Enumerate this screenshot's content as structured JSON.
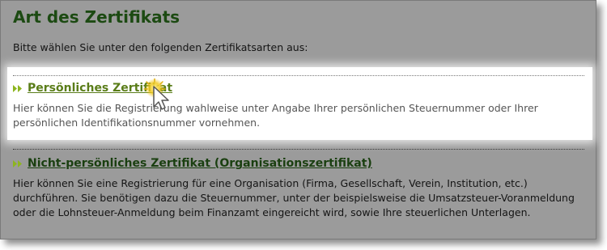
{
  "title": "Art des Zertifikats",
  "intro": "Bitte wählen Sie unter den folgenden Zertifikatsarten aus:",
  "options": [
    {
      "label": "Persönliches Zertifikat",
      "description": "Hier können Sie die Registrierung wahlweise unter Angabe Ihrer persönlichen Steuernummer oder Ihrer persönlichen Identifikationsnummer vornehmen."
    },
    {
      "label": "Nicht-persönliches Zertifikat (Organisationszertifikat)",
      "description": "Hier können Sie eine Registrierung für eine Organisation (Firma, Gesellschaft, Verein, Institution, etc.) durchführen. Sie benötigen dazu die Steuernummer, unter der beispielsweise die Umsatzsteuer-Voranmeldung oder die Lohnsteuer-Anmeldung beim Finanzamt eingereicht wird, sowie Ihre steuerlichen Unterlagen."
    }
  ],
  "colors": {
    "panel_background": "#9b9b9b",
    "highlight_background": "#ffffff",
    "title": "#1c4a12",
    "link_hover": "#5a7d19",
    "link": "#1a3f10",
    "arrow_icon": "#8db51f",
    "cursor_glow": "#f2c81c"
  },
  "icons": {
    "link_marker": "double-chevron-right-icon",
    "cursor": "mouse-pointer-icon"
  }
}
